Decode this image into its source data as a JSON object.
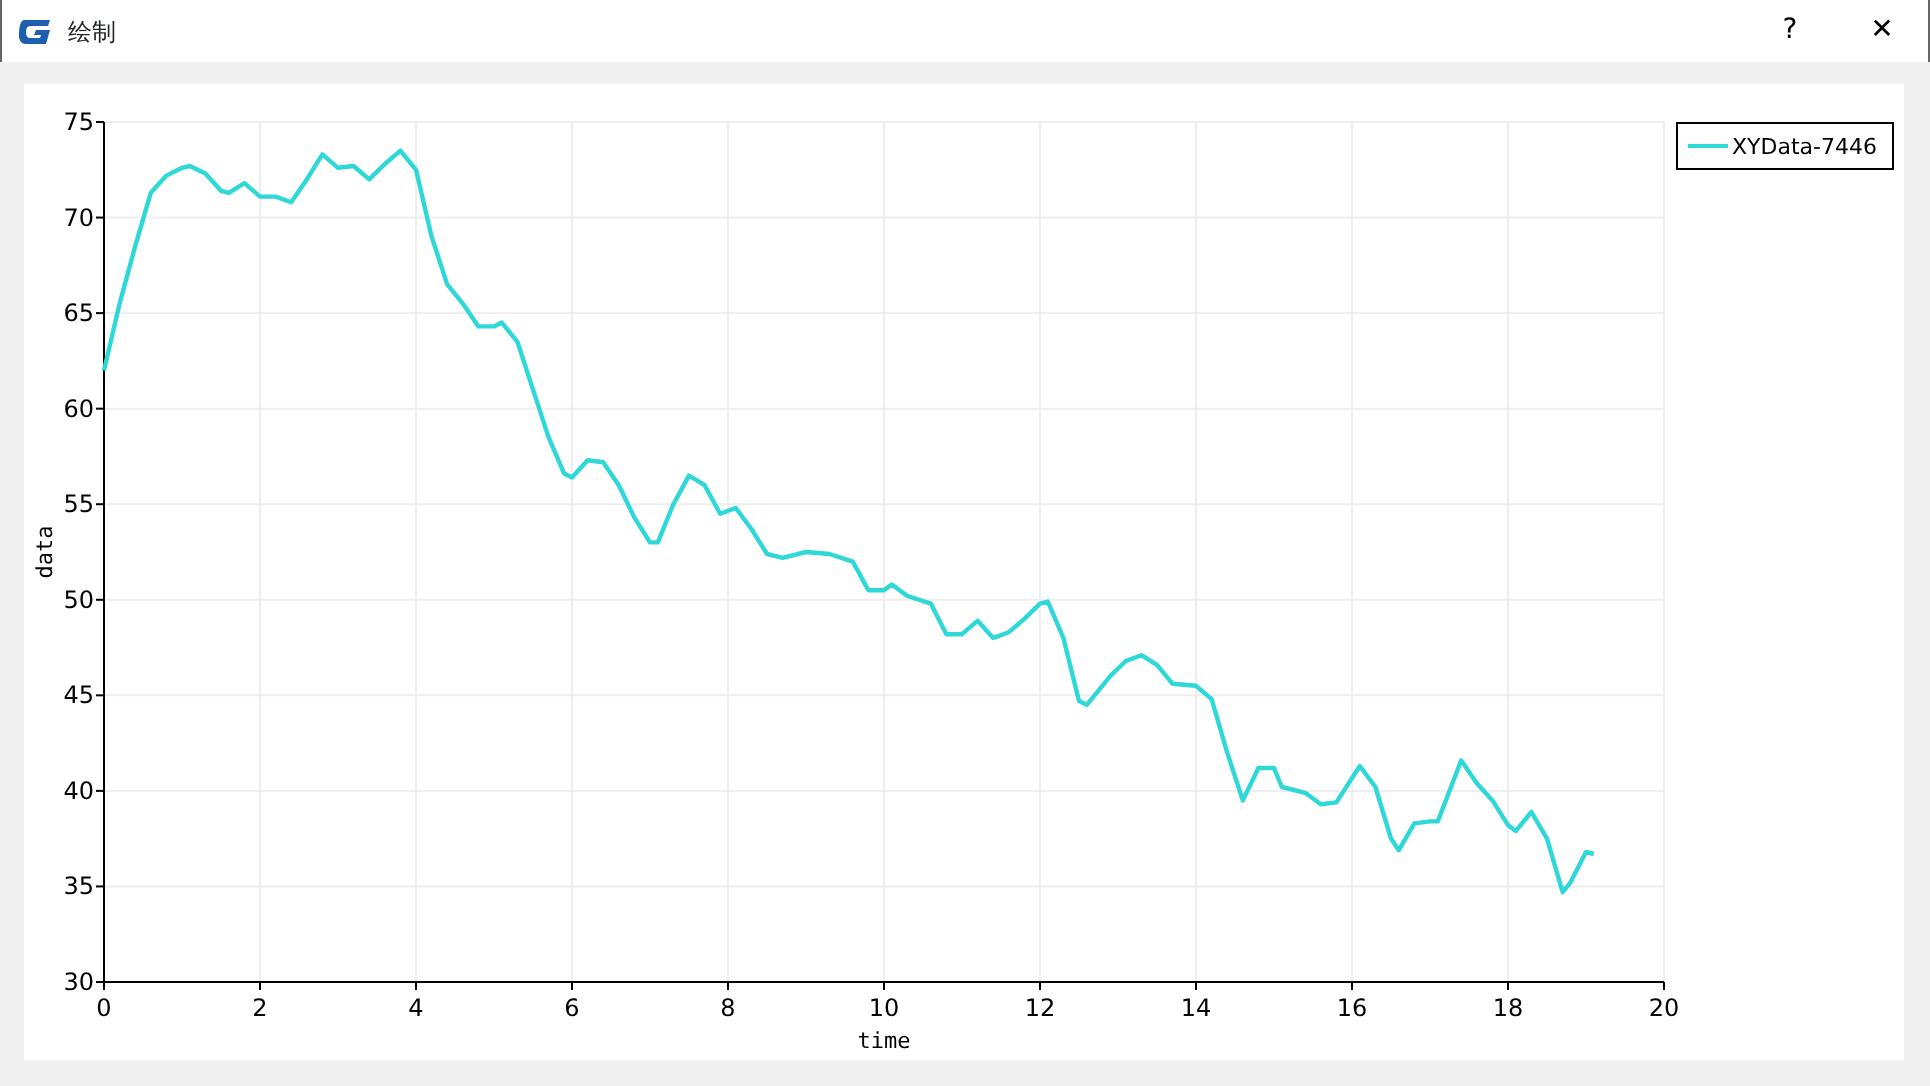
{
  "window": {
    "title": "绘制",
    "buttons": [
      "?",
      "✕"
    ]
  },
  "plot": {
    "chart_data": {
      "type": "line",
      "grid": true,
      "xlabel": "time",
      "ylabel": "data",
      "xlim": [
        0,
        20
      ],
      "ylim": [
        30,
        75
      ],
      "xticks": [
        0,
        2,
        4,
        6,
        8,
        10,
        12,
        14,
        16,
        18,
        20
      ],
      "yticks": [
        30,
        35,
        40,
        45,
        50,
        55,
        60,
        65,
        70,
        75
      ],
      "x": [
        0,
        0.2,
        0.4,
        0.6,
        0.8,
        1.0,
        1.1,
        1.3,
        1.5,
        1.6,
        1.8,
        2.0,
        2.2,
        2.4,
        2.6,
        2.8,
        3.0,
        3.2,
        3.4,
        3.6,
        3.8,
        4.0,
        4.2,
        4.4,
        4.6,
        4.8,
        5.0,
        5.1,
        5.3,
        5.5,
        5.7,
        5.9,
        6.0,
        6.2,
        6.4,
        6.6,
        6.8,
        7.0,
        7.1,
        7.3,
        7.5,
        7.7,
        7.9,
        8.1,
        8.3,
        8.5,
        8.7,
        9.0,
        9.3,
        9.6,
        9.8,
        10.0,
        10.1,
        10.3,
        10.6,
        10.8,
        11.0,
        11.2,
        11.4,
        11.6,
        11.8,
        12.0,
        12.1,
        12.3,
        12.5,
        12.6,
        12.9,
        13.1,
        13.3,
        13.5,
        13.7,
        14.0,
        14.2,
        14.4,
        14.6,
        14.8,
        15.0,
        15.1,
        15.4,
        15.6,
        15.8,
        16.1,
        16.3,
        16.5,
        16.6,
        16.8,
        17.0,
        17.1,
        17.4,
        17.6,
        17.8,
        18.0,
        18.1,
        18.3,
        18.5,
        18.7,
        18.8,
        19.0,
        19.1
      ],
      "series": [
        {
          "name": "XYData-7446",
          "color": "#2ed8d8",
          "values": [
            62,
            65.5,
            68.5,
            71.3,
            72.2,
            72.6,
            72.7,
            72.3,
            71.4,
            71.3,
            71.8,
            71.1,
            71.1,
            70.8,
            72.0,
            73.3,
            72.6,
            72.7,
            72.0,
            72.8,
            73.5,
            72.5,
            69.0,
            66.5,
            65.5,
            64.3,
            64.3,
            64.5,
            63.5,
            61.0,
            58.5,
            56.6,
            56.4,
            57.3,
            57.2,
            56,
            54.3,
            53.0,
            53.0,
            55,
            56.5,
            56,
            54.5,
            54.8,
            53.7,
            52.4,
            52.2,
            52.5,
            52.4,
            52,
            50.5,
            50.5,
            50.8,
            50.2,
            49.8,
            48.2,
            48.2,
            48.9,
            48,
            48.3,
            49,
            49.8,
            49.9,
            48,
            44.7,
            44.5,
            46,
            46.8,
            47.1,
            46.6,
            45.6,
            45.5,
            44.8,
            42,
            39.5,
            41.2,
            41.2,
            40.2,
            39.9,
            39.3,
            39.4,
            41.3,
            40.2,
            37.5,
            36.9,
            38.3,
            38.4,
            38.4,
            41.6,
            40.4,
            39.5,
            38.2,
            37.9,
            38.9,
            37.5,
            34.7,
            35.2,
            36.8,
            36.7
          ]
        }
      ]
    }
  }
}
